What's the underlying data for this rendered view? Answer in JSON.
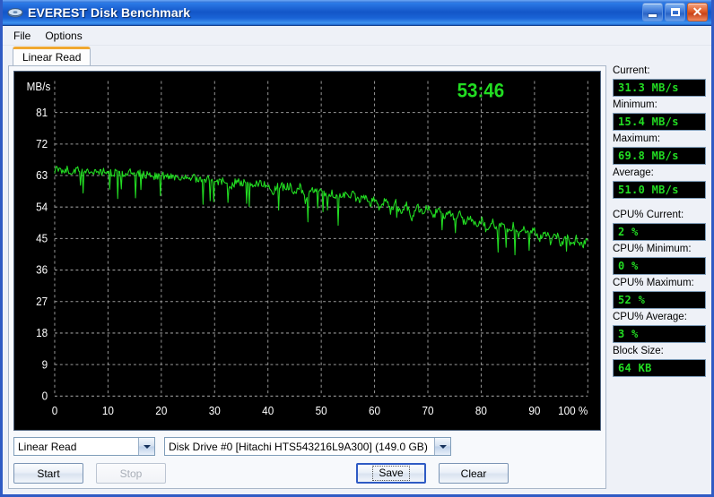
{
  "window": {
    "title": "EVEREST Disk Benchmark",
    "icon": "disk-platter-icon",
    "buttons": {
      "minimize": "minimize-icon",
      "maximize": "maximize-icon",
      "close": "close-icon"
    }
  },
  "menu": {
    "items": [
      {
        "label": "File"
      },
      {
        "label": "Options"
      }
    ]
  },
  "tabs": [
    {
      "label": "Linear Read",
      "selected": true
    }
  ],
  "chart_overlay": {
    "timer": "53:46"
  },
  "controls": {
    "mode_select": {
      "value": "Linear Read"
    },
    "drive_select": {
      "value": "Disk Drive #0  [Hitachi HTS543216L9A300]  (149.0 GB)"
    },
    "start_button": "Start",
    "stop_button": "Stop",
    "save_button": "Save",
    "clear_button": "Clear"
  },
  "stats": [
    {
      "label": "Current:",
      "value": "31.3 MB/s"
    },
    {
      "label": "Minimum:",
      "value": "15.4 MB/s"
    },
    {
      "label": "Maximum:",
      "value": "69.8 MB/s"
    },
    {
      "label": "Average:",
      "value": "51.0 MB/s"
    },
    {
      "label": "CPU% Current:",
      "value": "2 %",
      "gap": true
    },
    {
      "label": "CPU% Minimum:",
      "value": "0 %"
    },
    {
      "label": "CPU% Maximum:",
      "value": "52 %"
    },
    {
      "label": "CPU% Average:",
      "value": "3 %"
    },
    {
      "label": "Block Size:",
      "value": "64 KB"
    }
  ],
  "colors": {
    "plot_line": "#22dd22",
    "timer": "#22dd22",
    "grid": "#9a9a9a",
    "chart_bg": "#000000",
    "accent": "#2f5bc4",
    "tab_accent": "#f0a830"
  },
  "chart_data": {
    "type": "line",
    "title": "",
    "xlabel": "%",
    "ylabel": "MB/s",
    "xlim": [
      0,
      100
    ],
    "ylim": [
      0,
      90
    ],
    "xticks": [
      0,
      10,
      20,
      30,
      40,
      50,
      60,
      70,
      80,
      90,
      100
    ],
    "xtick_labels": [
      "0",
      "10",
      "20",
      "30",
      "40",
      "50",
      "60",
      "70",
      "80",
      "90",
      "100 %"
    ],
    "yticks": [
      0,
      9,
      18,
      27,
      36,
      45,
      54,
      63,
      72,
      81
    ],
    "ytick_labels": [
      "0",
      "9",
      "18",
      "27",
      "36",
      "45",
      "54",
      "63",
      "72",
      "81"
    ],
    "grid": true,
    "legend": false,
    "series": [
      {
        "name": "Linear Read",
        "color": "#22dd22",
        "x": [
          0,
          1,
          2,
          3,
          4,
          5,
          6,
          7,
          8,
          9,
          10,
          11,
          12,
          13,
          14,
          15,
          16,
          17,
          18,
          19,
          20,
          21,
          22,
          23,
          24,
          25,
          26,
          27,
          28,
          29,
          30,
          31,
          32,
          33,
          34,
          35,
          36,
          37,
          38,
          39,
          40,
          41,
          42,
          43,
          44,
          45,
          46,
          47,
          48,
          49,
          50,
          51,
          52,
          53,
          54,
          55,
          56,
          57,
          58,
          59,
          60,
          61,
          62,
          63,
          64,
          65,
          66,
          67,
          68,
          69,
          70,
          71,
          72,
          73,
          74,
          75,
          76,
          77,
          78,
          79,
          80,
          81,
          82,
          83,
          84,
          85,
          86,
          87,
          88,
          89,
          90,
          91,
          92,
          93,
          94,
          95,
          96,
          97,
          98,
          99,
          100
        ],
        "values": [
          64.6,
          64.2,
          64.8,
          63.9,
          64.5,
          64.1,
          64.7,
          63.6,
          64.3,
          63.8,
          64.4,
          63.5,
          64.0,
          63.3,
          63.9,
          63.1,
          63.7,
          62.8,
          63.4,
          62.6,
          63.2,
          62.4,
          63.0,
          62.2,
          62.8,
          61.4,
          62.5,
          61.0,
          62.2,
          61.6,
          62.0,
          60.8,
          61.6,
          59.2,
          61.4,
          60.6,
          61.2,
          59.8,
          61.0,
          60.2,
          60.6,
          58.0,
          60.2,
          59.6,
          60.0,
          58.4,
          59.6,
          55.8,
          59.2,
          58.6,
          58.8,
          57.2,
          58.4,
          56.0,
          58.0,
          56.6,
          57.6,
          55.4,
          57.0,
          54.4,
          56.4,
          53.6,
          55.8,
          53.0,
          55.2,
          52.2,
          54.6,
          51.0,
          54.0,
          52.6,
          53.6,
          51.6,
          53.0,
          51.2,
          52.4,
          50.4,
          51.8,
          49.2,
          51.2,
          48.6,
          50.6,
          47.4,
          50.0,
          47.8,
          49.4,
          46.4,
          48.8,
          45.6,
          48.2,
          46.0,
          47.6,
          44.8,
          47.0,
          44.2,
          46.4,
          43.4,
          45.8,
          42.6,
          45.2,
          43.0,
          44.6
        ]
      }
    ],
    "annotations": [
      {
        "text": "53:46",
        "x": 68,
        "y": 84,
        "color": "#22dd22"
      }
    ]
  }
}
